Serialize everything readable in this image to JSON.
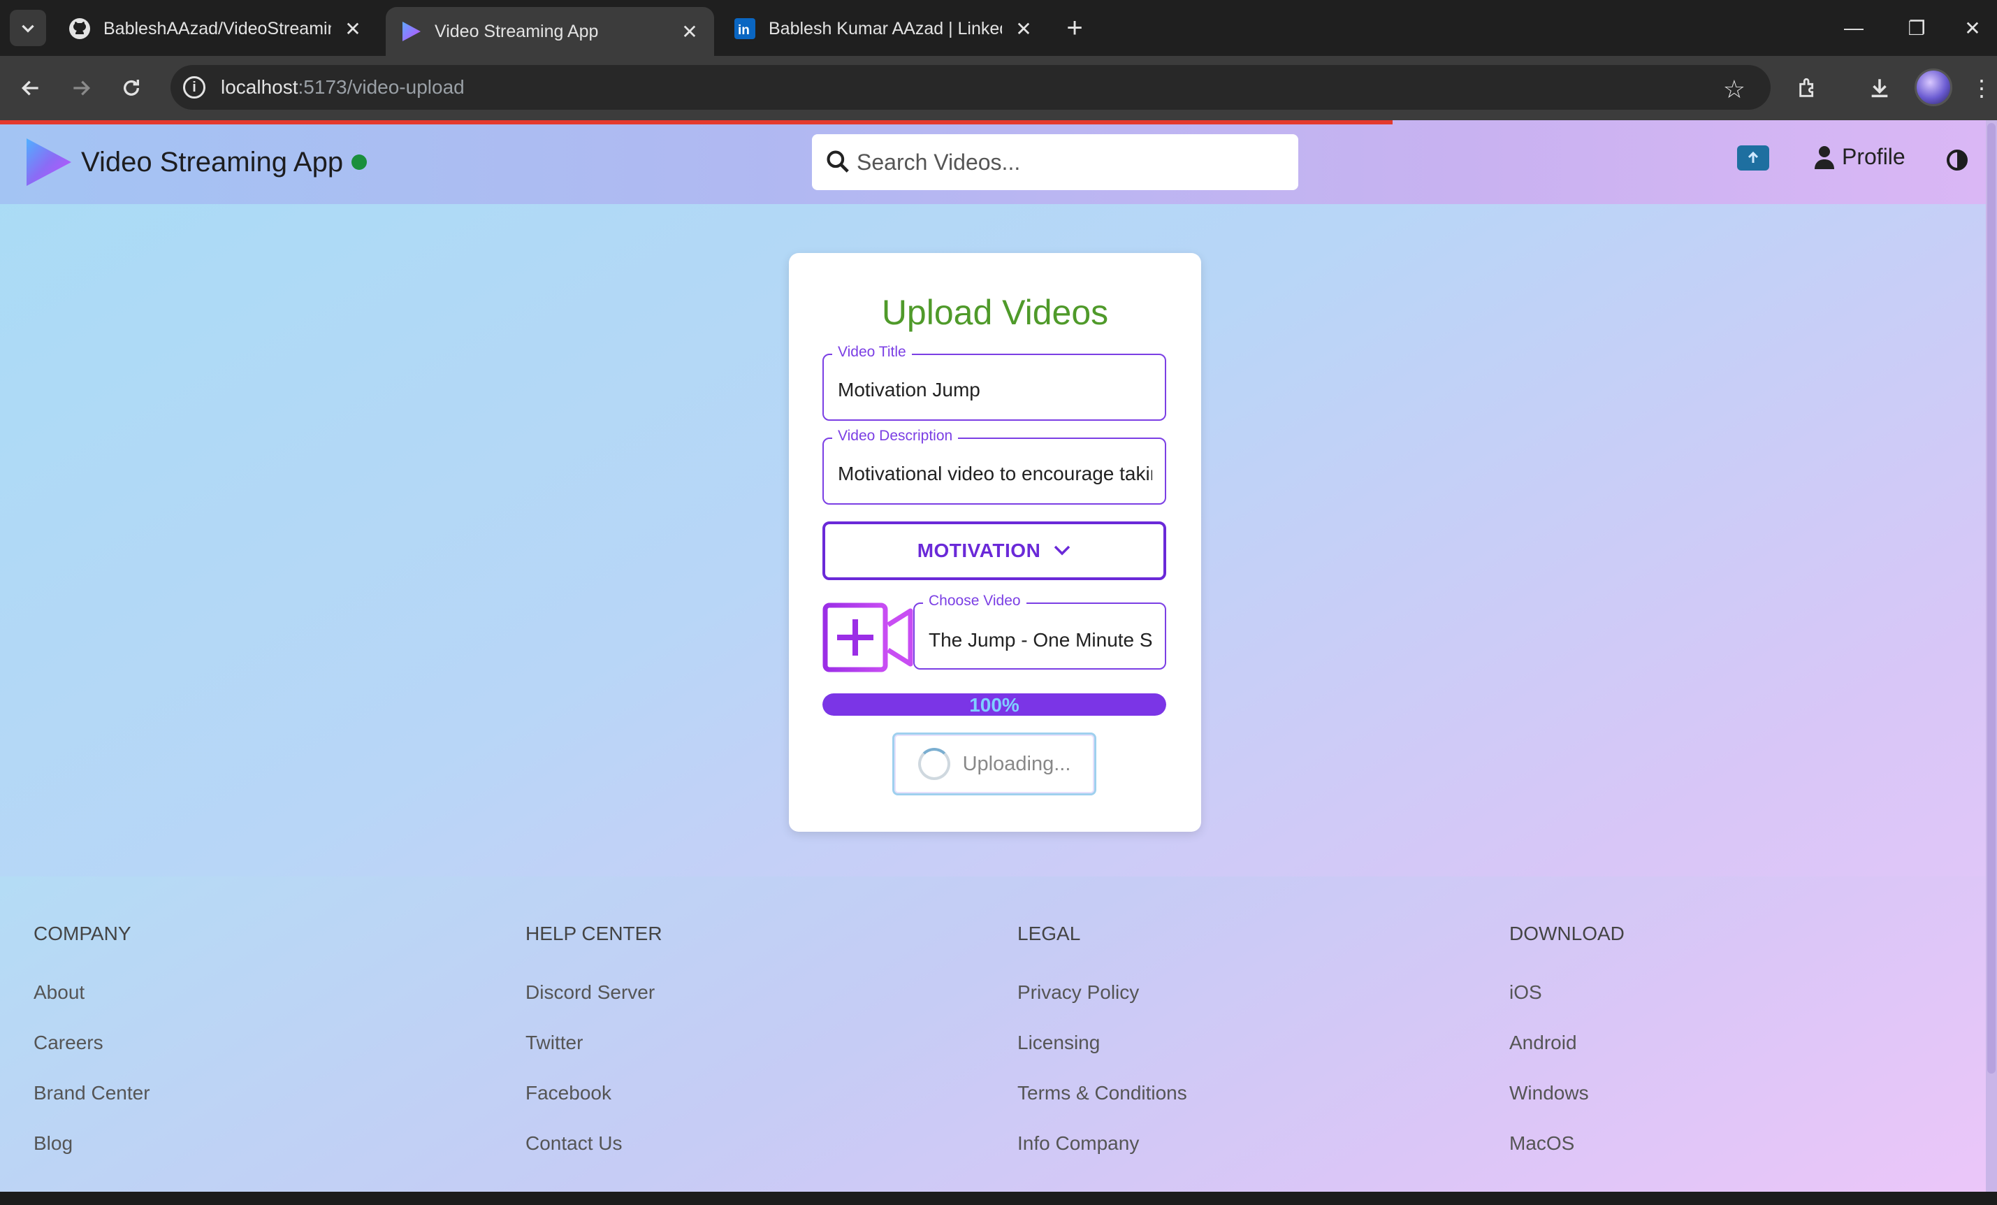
{
  "browser": {
    "tabs": [
      {
        "title": "BableshAAzad/VideoStreaming",
        "icon": "github-icon"
      },
      {
        "title": "Video Streaming App",
        "icon": "play-logo-icon",
        "active": true
      },
      {
        "title": "Bablesh Kumar AAzad | LinkedIn",
        "icon": "linkedin-icon"
      }
    ],
    "url_host": "localhost",
    "url_path": ":5173/video-upload"
  },
  "app": {
    "brand": "Video Streaming App",
    "search_placeholder": "Search Videos...",
    "profile_label": "Profile"
  },
  "upload": {
    "heading": "Upload Videos",
    "title_label": "Video Title",
    "title_value": "Motivation Jump",
    "description_label": "Video Description",
    "description_value": "Motivational video to encourage taking the leap",
    "category_value": "MOTIVATION",
    "choose_label": "Choose Video",
    "choose_value": "The Jump - One Minute Short Film",
    "progress": 100,
    "progress_text": "100%",
    "button_label": "Uploading..."
  },
  "footer": {
    "columns": [
      {
        "heading": "COMPANY",
        "links": [
          "About",
          "Careers",
          "Brand Center",
          "Blog"
        ]
      },
      {
        "heading": "HELP CENTER",
        "links": [
          "Discord Server",
          "Twitter",
          "Facebook",
          "Contact Us"
        ]
      },
      {
        "heading": "LEGAL",
        "links": [
          "Privacy Policy",
          "Licensing",
          "Terms & Conditions",
          "Info Company"
        ]
      },
      {
        "heading": "DOWNLOAD",
        "links": [
          "iOS",
          "Android",
          "Windows",
          "MacOS"
        ]
      }
    ]
  },
  "colors": {
    "accent_purple": "#7b3fe4",
    "heading_green": "#4f9a2a",
    "progress_fill": "#7b35e6"
  }
}
